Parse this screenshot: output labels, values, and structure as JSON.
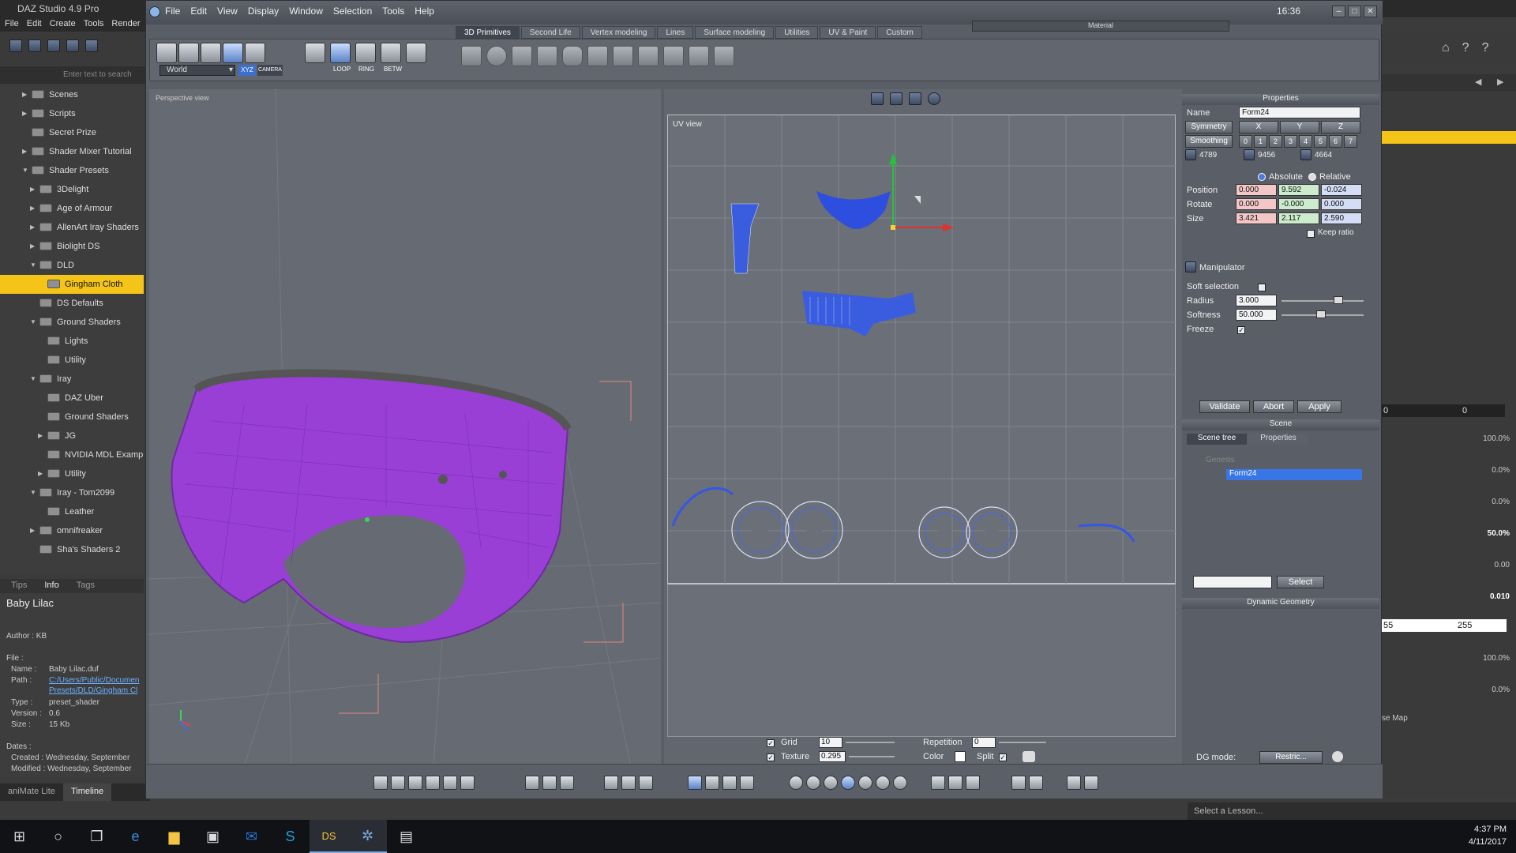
{
  "daz": {
    "title": "DAZ Studio 4.9 Pro",
    "menu": [
      "File",
      "Edit",
      "Create",
      "Tools",
      "Render"
    ],
    "search_placeholder": "Enter text to search",
    "tree": [
      {
        "label": "Scenes",
        "level": 0,
        "arrow": "▶"
      },
      {
        "label": "Scripts",
        "level": 0,
        "arrow": "▶"
      },
      {
        "label": "Secret Prize",
        "level": 0,
        "arrow": ""
      },
      {
        "label": "Shader Mixer Tutorial",
        "level": 0,
        "arrow": "▶"
      },
      {
        "label": "Shader Presets",
        "level": 0,
        "arrow": "▼"
      },
      {
        "label": "3Delight",
        "level": 1,
        "arrow": "▶"
      },
      {
        "label": "Age of Armour",
        "level": 1,
        "arrow": "▶"
      },
      {
        "label": "AllenArt Iray Shaders",
        "level": 1,
        "arrow": "▶"
      },
      {
        "label": "Biolight DS",
        "level": 1,
        "arrow": "▶"
      },
      {
        "label": "DLD",
        "level": 1,
        "arrow": "▼"
      },
      {
        "label": "Gingham Cloth",
        "level": 2,
        "arrow": "",
        "selected": true
      },
      {
        "label": "DS Defaults",
        "level": 1,
        "arrow": ""
      },
      {
        "label": "Ground Shaders",
        "level": 1,
        "arrow": "▼"
      },
      {
        "label": "Lights",
        "level": 2,
        "arrow": ""
      },
      {
        "label": "Utility",
        "level": 2,
        "arrow": ""
      },
      {
        "label": "Iray",
        "level": 1,
        "arrow": "▼"
      },
      {
        "label": "DAZ Uber",
        "level": 2,
        "arrow": ""
      },
      {
        "label": "Ground Shaders",
        "level": 2,
        "arrow": ""
      },
      {
        "label": "JG",
        "level": 2,
        "arrow": "▶"
      },
      {
        "label": "NVIDIA MDL Exampl",
        "level": 2,
        "arrow": ""
      },
      {
        "label": "Utility",
        "level": 2,
        "arrow": "▶"
      },
      {
        "label": "Iray - Tom2099",
        "level": 1,
        "arrow": "▼"
      },
      {
        "label": "Leather",
        "level": 2,
        "arrow": ""
      },
      {
        "label": "omnifreaker",
        "level": 1,
        "arrow": "▶"
      },
      {
        "label": "Sha's Shaders 2",
        "level": 1,
        "arrow": ""
      }
    ],
    "panel_tabs": [
      "Tips",
      "Info",
      "Tags"
    ],
    "info": {
      "title": "Baby Lilac",
      "author": "Author : KB",
      "file_label": "File :",
      "name_label": "Name :",
      "name": "Baby Lilac.duf",
      "path_label": "Path :",
      "path1": "C:/Users/Public/Documen",
      "path2": "Presets/DLD/Gingham Cl",
      "type_label": "Type :",
      "type": "preset_shader",
      "version_label": "Version :",
      "version": "0.6",
      "size_label": "Size :",
      "size": "15 Kb",
      "dates_label": "Dates :",
      "created": "Created : Wednesday, September",
      "modified": "Modified : Wednesday, September"
    },
    "bottom_tabs": [
      "aniMate Lite",
      "Timeline"
    ],
    "right_values": {
      "v1": "0",
      "v2": "0",
      "p1": "100.0%",
      "p2": "0.0%",
      "p3": "0.0%",
      "p4": "50.0%",
      "p5": "0.00",
      "p6": "0.010",
      "c1": "55",
      "c2": "255",
      "p7": "100.0%",
      "p8": "0.0%",
      "map": "se Map"
    },
    "lesson_placeholder": "Select a Lesson...",
    "clock_time": "4:37 PM",
    "clock_date": "4/11/2017"
  },
  "hexagon": {
    "menu": [
      "File",
      "Edit",
      "View",
      "Display",
      "Window",
      "Selection",
      "Tools",
      "Help"
    ],
    "time": "16:36",
    "tabs": [
      "3D Primitives",
      "Second Life",
      "Vertex modeling",
      "Lines",
      "Surface modeling",
      "Utilities",
      "UV & Paint",
      "Custom"
    ],
    "material_title": "Material",
    "world_label": "World",
    "xyz_label": "XYZ",
    "camera_label": "CAMERA",
    "loop_labels": [
      "LOOP",
      "RING",
      "BETW"
    ],
    "perspective_label": "Perspective view",
    "uv_label": "UV view",
    "uv_controls": {
      "grid_label": "Grid",
      "grid_value": "10",
      "texture_label": "Texture",
      "texture_value": "0.295",
      "repetition_label": "Repetition",
      "repetition_value": "0",
      "color_label": "Color",
      "split_label": "Split"
    },
    "properties": {
      "title": "Properties",
      "name_label": "Name",
      "name_value": "Form24",
      "symmetry_label": "Symmetry",
      "sym_axes": [
        "X",
        "Y",
        "Z"
      ],
      "smoothing_label": "Smoothing",
      "smoothing_levels": [
        "0",
        "1",
        "2",
        "3",
        "4",
        "5",
        "6",
        "7"
      ],
      "count1": "4789",
      "count2": "9456",
      "count3": "4664",
      "absolute_label": "Absolute",
      "relative_label": "Relative",
      "position_label": "Position",
      "position": [
        "0.000",
        "9.592",
        "-0.024"
      ],
      "rotate_label": "Rotate",
      "rotate": [
        "0.000",
        "-0.000",
        "0.000"
      ],
      "size_label": "Size",
      "size": [
        "3.421",
        "2.117",
        "2.590"
      ],
      "keep_ratio_label": "Keep ratio",
      "manipulator_label": "Manipulator",
      "soft_selection_label": "Soft selection",
      "radius_label": "Radius",
      "radius_value": "3.000",
      "softness_label": "Softness",
      "softness_value": "50.000",
      "freeze_label": "Freeze",
      "validate": "Validate",
      "abort": "Abort",
      "apply": "Apply"
    },
    "scene": {
      "title": "Scene",
      "tabs": [
        "Scene tree",
        "Properties"
      ],
      "items": [
        "Genesis",
        "Form24"
      ],
      "select_label": "Select"
    },
    "dynamic_geometry_title": "Dynamic Geometry",
    "dg_mode_label": "DG mode:",
    "dg_mode_value": "Restric..."
  }
}
